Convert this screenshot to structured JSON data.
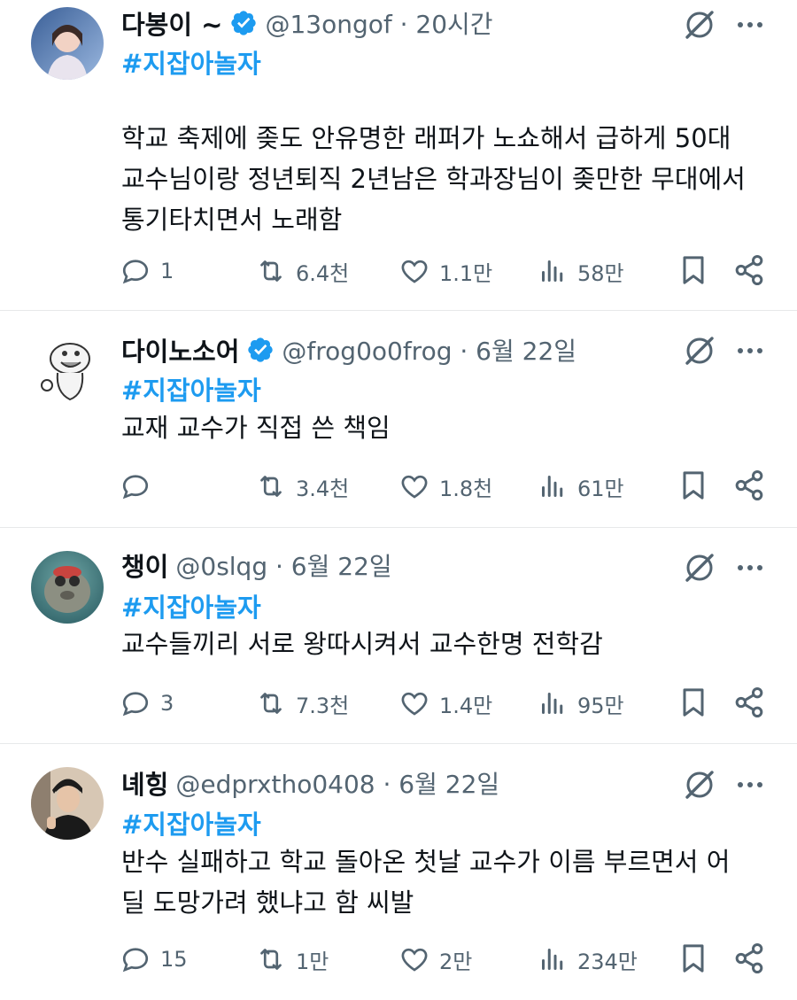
{
  "tweets": [
    {
      "name": "다봉이 ~",
      "verified": true,
      "handle": "@13ongof · 20시간",
      "hashtag": "#지잡아놀자",
      "text_lines": [
        "학교 축제에 좆도 안유명한 래퍼가 노쇼해서 급하게 50대",
        "교수님이랑 정년퇴직 2년남은 학과장님이 좆만한 무대에서",
        "통기타치면서 노래함"
      ],
      "replies": "1",
      "reposts": "6.4천",
      "likes": "1.1만",
      "views": "58만"
    },
    {
      "name": "다이노소어",
      "verified": true,
      "handle": "@frog0o0frog · 6월 22일",
      "hashtag": "#지잡아놀자",
      "text_lines": [
        "교재 교수가 직접 쓴 책임"
      ],
      "replies": "",
      "reposts": "3.4천",
      "likes": "1.8천",
      "views": "61만"
    },
    {
      "name": "챙이",
      "verified": false,
      "handle": "@0slqg · 6월 22일",
      "hashtag": "#지잡아놀자",
      "text_lines": [
        "교수들끼리 서로 왕따시켜서 교수한명 전학감"
      ],
      "replies": "3",
      "reposts": "7.3천",
      "likes": "1.4만",
      "views": "95만"
    },
    {
      "name": "녜힝",
      "verified": false,
      "handle": "@edprxtho0408 · 6월 22일",
      "hashtag": "#지잡아놀자",
      "text_lines": [
        "반수 실패하고 학교 돌아온 첫날 교수가 이름 부르면서 어",
        "딜 도망가려 했냐고 함 씨발"
      ],
      "replies": "15",
      "reposts": "1만",
      "likes": "2만",
      "views": "234만"
    }
  ],
  "colors": {
    "accent": "#1d9bf0",
    "text": "#0f1419",
    "muted": "#536471",
    "divider": "#e7e9ea"
  },
  "icons": [
    "grok-icon",
    "more-icon",
    "reply-icon",
    "repost-icon",
    "like-icon",
    "views-icon",
    "bookmark-icon",
    "share-icon",
    "verified-badge-icon"
  ]
}
